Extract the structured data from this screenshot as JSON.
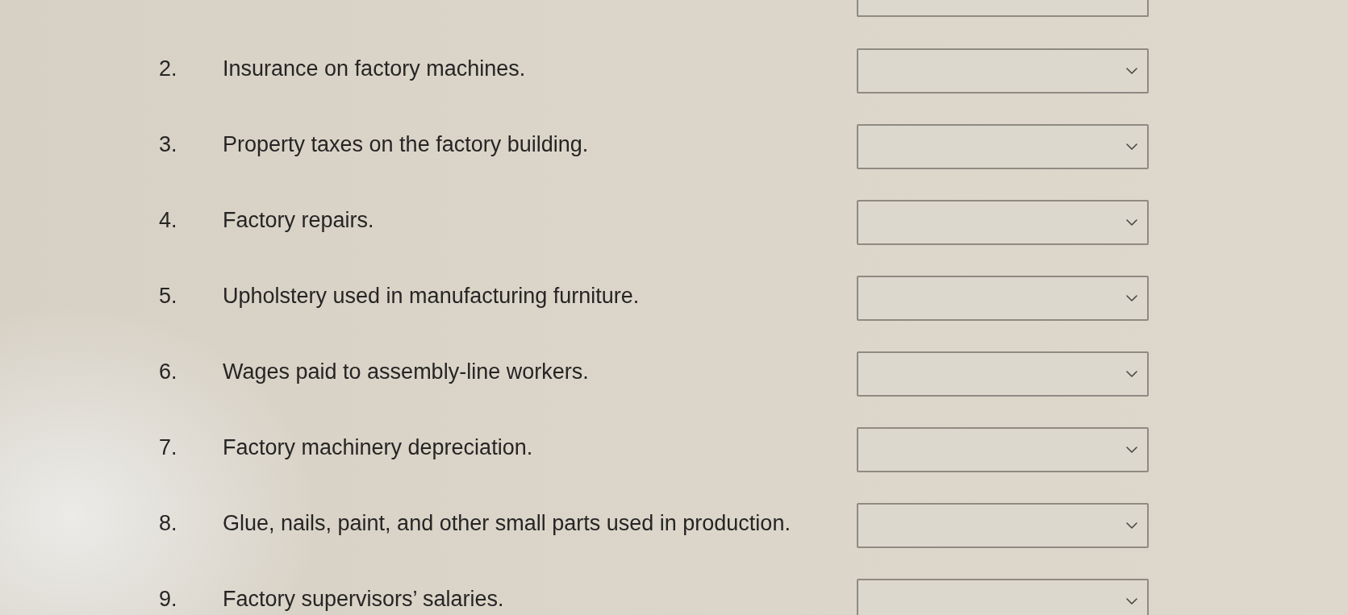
{
  "questions": [
    {
      "number": "2.",
      "text": "Insurance on factory machines."
    },
    {
      "number": "3.",
      "text": "Property taxes on the factory building."
    },
    {
      "number": "4.",
      "text": "Factory repairs."
    },
    {
      "number": "5.",
      "text": "Upholstery used in manufacturing furniture."
    },
    {
      "number": "6.",
      "text": "Wages paid to assembly-line workers."
    },
    {
      "number": "7.",
      "text": "Factory machinery depreciation."
    },
    {
      "number": "8.",
      "text": "Glue, nails, paint, and other small parts used in production."
    },
    {
      "number": "9.",
      "text": "Factory supervisors’ salaries."
    }
  ]
}
